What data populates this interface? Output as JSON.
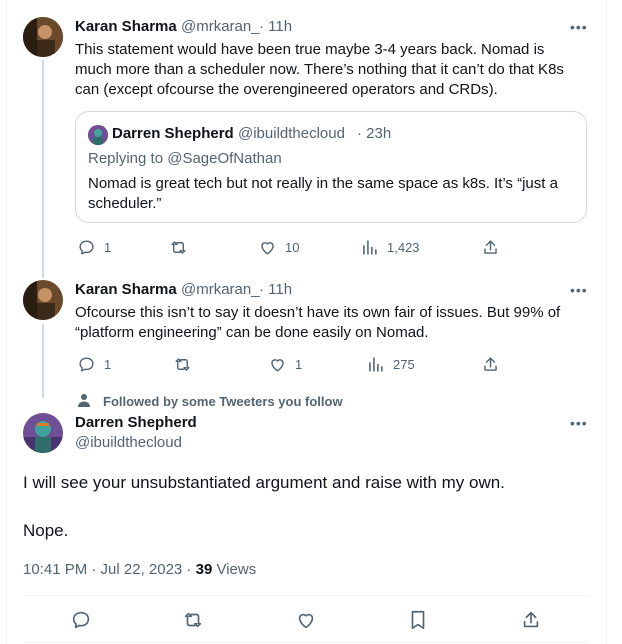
{
  "reply1": {
    "name": "Karan Sharma",
    "handle": "@mrkaran_",
    "time": "· 11h",
    "lines": [
      "This statement would have been true maybe 3-4 years back. Nomad is",
      "much more than a scheduler now. There’s nothing that it can’t do that K8s",
      "can (except ofcourse the overengineered operators and CRDs)."
    ],
    "quote": {
      "name": "Darren Shepherd",
      "handle": "@ibuildthecloud",
      "time": "· 23h",
      "replying": "Replying to @SageOfNathan",
      "lines": [
        "Nomad is great tech but not really in the same space as k8s. It’s “just a",
        "scheduler.”"
      ]
    },
    "stats": {
      "replies": "1",
      "retweets": "",
      "likes": "10",
      "views": "1,423"
    }
  },
  "reply2": {
    "name": "Karan Sharma",
    "handle": "@mrkaran_",
    "time": "· 11h",
    "lines": [
      "Ofcourse this isn’t to say it doesn’t have its own fair of issues. But 99% of",
      "“platform engineering” can be done easily on Nomad."
    ],
    "stats": {
      "replies": "1",
      "retweets": "",
      "likes": "1",
      "views": "275"
    }
  },
  "main": {
    "social_context": "Followed by some Tweeters you follow",
    "name": "Darren Shepherd",
    "handle": "@ibuildthecloud",
    "text1": "I will see your unsubstantiated argument and raise with my own.",
    "text2": "Nope.",
    "timestamp": "10:41 PM · Jul 22, 2023 ·",
    "views_count": "39",
    "views_label": "Views"
  },
  "more_glyph": "•••",
  "colors": {
    "muted": "#536471",
    "border": "#eff3f4",
    "line": "#cfd9de"
  }
}
